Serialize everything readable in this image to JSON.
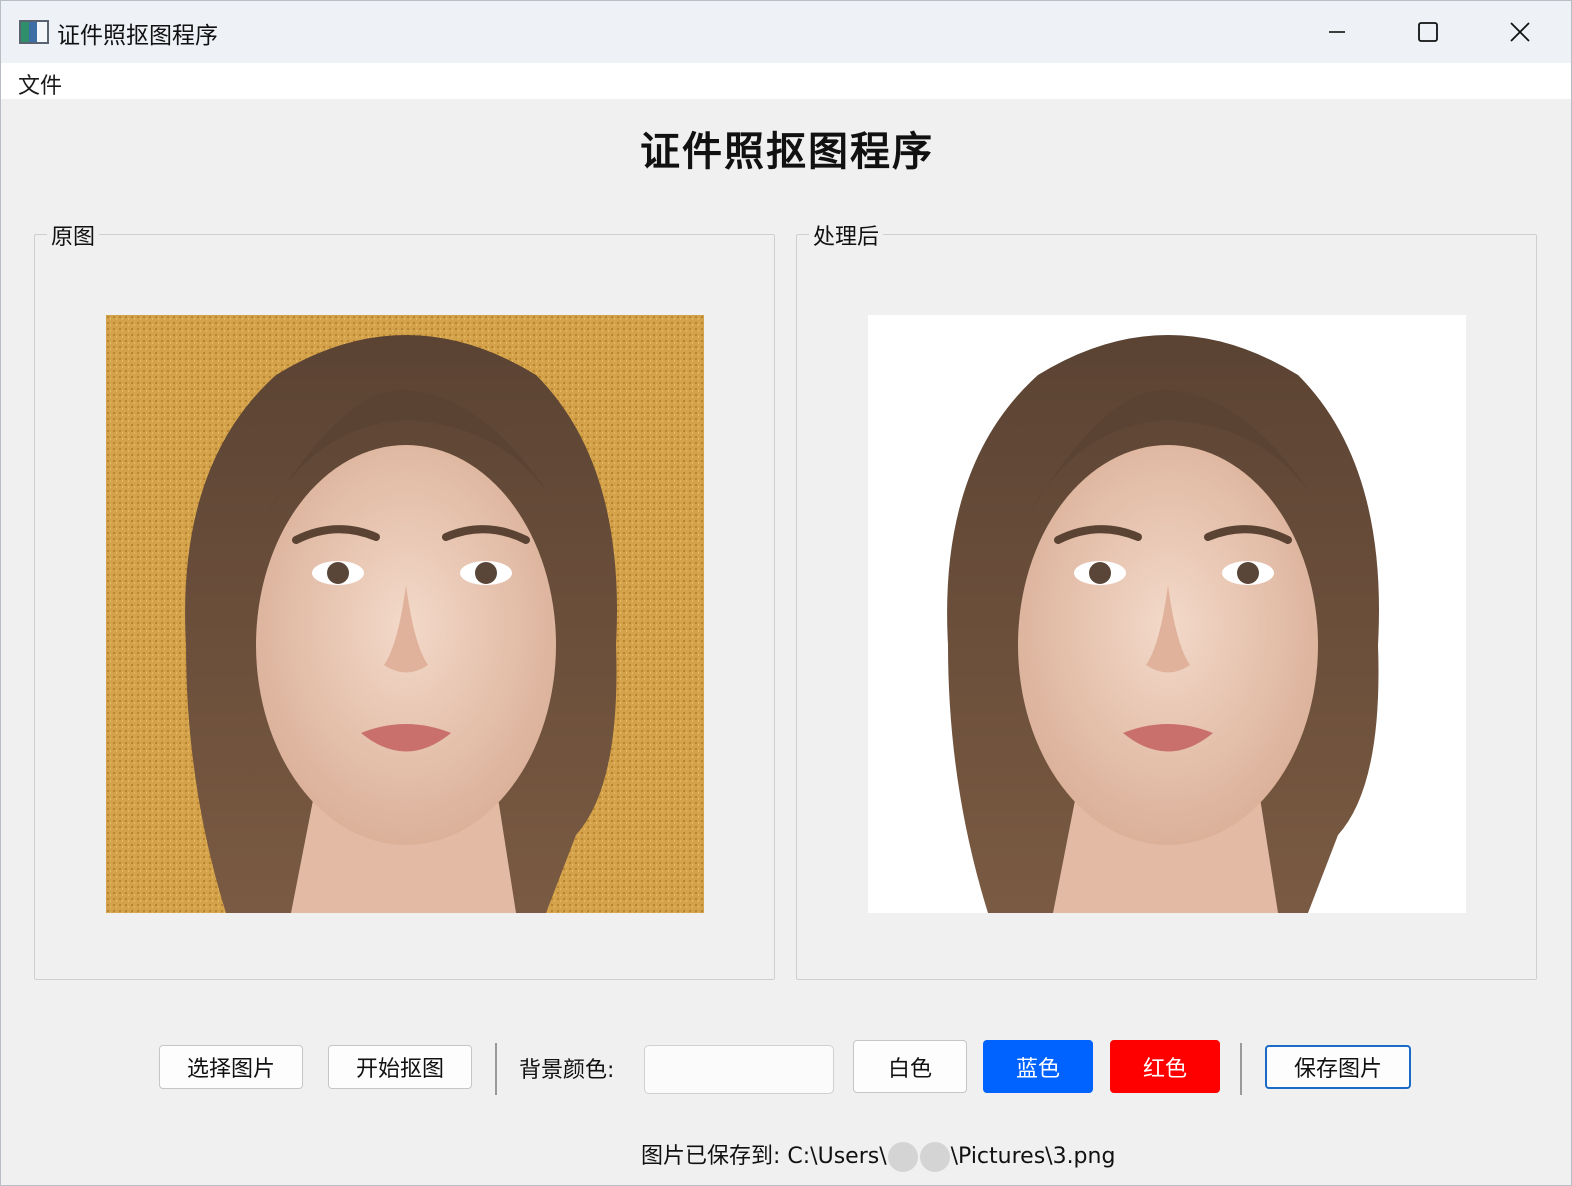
{
  "window": {
    "title": "证件照抠图程序",
    "controls": {
      "minimize_icon": "minimize-icon",
      "maximize_icon": "maximize-icon",
      "close_icon": "close-icon"
    }
  },
  "menu": {
    "items": [
      {
        "label": "文件"
      }
    ]
  },
  "heading": "证件照抠图程序",
  "panels": {
    "original": {
      "label": "原图",
      "background_color": "#d4a24a"
    },
    "processed": {
      "label": "处理后",
      "background_color": "#ffffff"
    }
  },
  "toolbar": {
    "select_image": "选择图片",
    "start_matting": "开始抠图",
    "bg_color_label": "背景颜色:",
    "bg_color_value": "",
    "white": {
      "label": "白色",
      "color": "#ffffff"
    },
    "blue": {
      "label": "蓝色",
      "color": "#0062ff"
    },
    "red": {
      "label": "红色",
      "color": "#ff0000"
    },
    "save_image": "保存图片"
  },
  "status": {
    "prefix": "图片已保存到: C:\\Users\\",
    "suffix": "\\Pictures\\3.png"
  }
}
